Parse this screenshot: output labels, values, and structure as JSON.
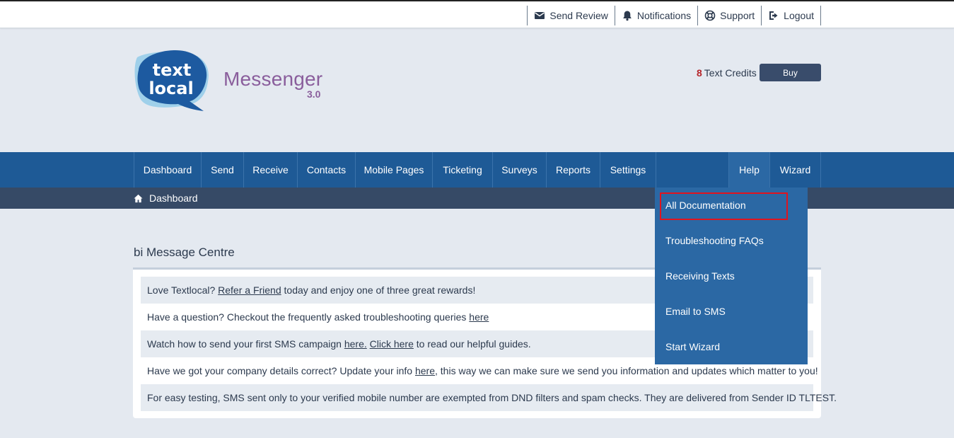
{
  "topbar": {
    "links": [
      {
        "label": "Send Review",
        "icon": "envelope-icon"
      },
      {
        "label": "Notifications",
        "icon": "bell-icon"
      },
      {
        "label": "Support",
        "icon": "lifebuoy-icon"
      },
      {
        "label": "Logout",
        "icon": "logout-icon"
      }
    ]
  },
  "header": {
    "logo_line1": "text",
    "logo_line2": "local",
    "brand": "Messenger",
    "version": "3.0",
    "credits_count": "8",
    "credits_label": "Text Credits",
    "buy_label": "Buy"
  },
  "nav": {
    "items": [
      "Dashboard",
      "Send",
      "Receive",
      "Contacts",
      "Mobile Pages",
      "Ticketing",
      "Surveys",
      "Reports",
      "Settings"
    ],
    "help": "Help",
    "wizard": "Wizard"
  },
  "breadcrumb": {
    "icon": "home-icon",
    "label": "Dashboard"
  },
  "help_menu": {
    "items": [
      "All Documentation",
      "Troubleshooting FAQs",
      "Receiving Texts",
      "Email to SMS",
      "Start Wizard"
    ],
    "highlighted": "All Documentation"
  },
  "message_centre": {
    "title": "bi Message Centre",
    "rows": [
      {
        "pre": "Love Textlocal? ",
        "link1": "Refer a Friend",
        "mid": " today and enjoy one of three great rewards!"
      },
      {
        "pre": "Have a question? Checkout the frequently asked troubleshooting queries ",
        "link1": "here"
      },
      {
        "pre": "Watch how to send your first SMS campaign ",
        "link1": "here.",
        "mid": " ",
        "link2": "Click here",
        "post": " to read our helpful guides."
      },
      {
        "pre": "Have we got your company details correct? Update your info ",
        "link1": "here",
        "mid": ", this way we can make sure we send you information and updates which matter to you!"
      },
      {
        "pre": "For easy testing, SMS sent only to your verified mobile number are exempted from DND filters and spam checks. They are delivered from Sender ID TLTEST."
      }
    ]
  },
  "colors": {
    "nav": "#1e5a96",
    "dropdown": "#2b68a4",
    "breadcrumb_bar": "#364a66",
    "brand": "#8a5e9c",
    "credits": "#b5252a",
    "highlight_box": "#e0141e"
  }
}
